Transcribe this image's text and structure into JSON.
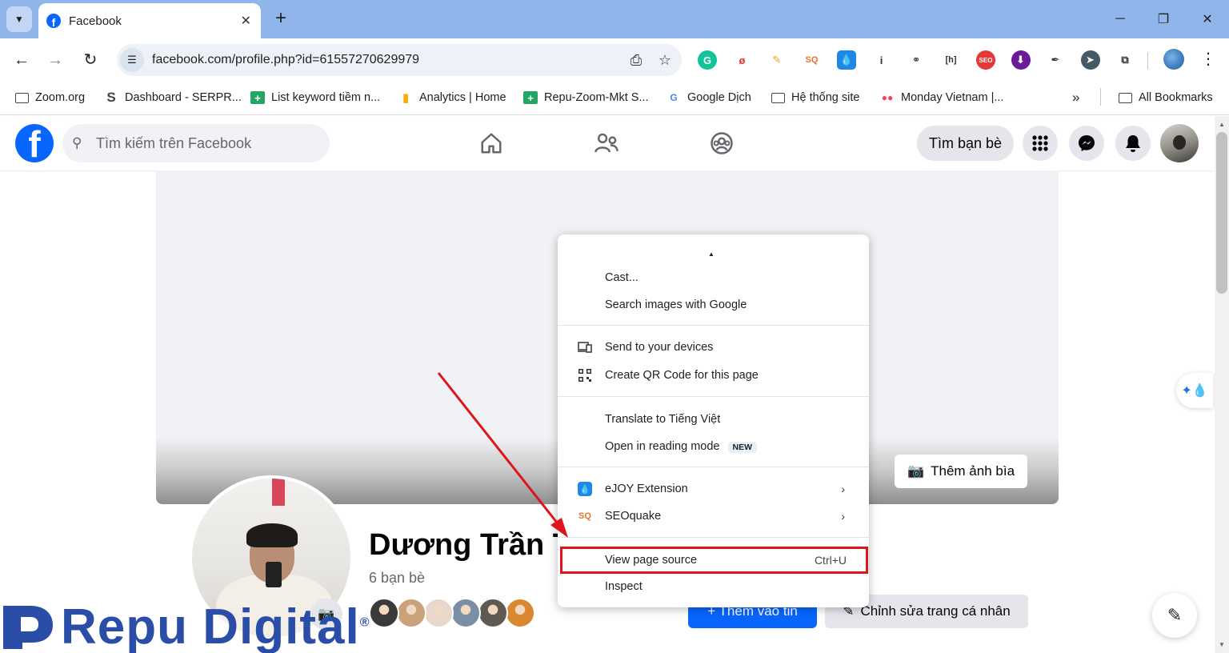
{
  "browser": {
    "tab_title": "Facebook",
    "tab_close": "✕",
    "new_tab": "+",
    "url": "facebook.com/profile.php?id=61557270629979",
    "window_controls": [
      "─",
      "❐",
      "✕"
    ],
    "extensions": [
      {
        "icon": "grammarly-icon",
        "glyph": "G",
        "color": "#15c39a"
      },
      {
        "icon": "ext-red-icon",
        "glyph": "ø",
        "color": "#ffffff"
      },
      {
        "icon": "highlighter-icon",
        "glyph": "✎",
        "color": "#ffffff"
      },
      {
        "icon": "seoquake-icon",
        "glyph": "SQ",
        "color": "#ffffff"
      },
      {
        "icon": "ejoy-icon",
        "glyph": "💧",
        "color": "#1e88e5"
      },
      {
        "icon": "info-icon",
        "glyph": "i",
        "color": "#ffffff"
      },
      {
        "icon": "link-icon",
        "glyph": "⚭",
        "color": "#ffffff"
      },
      {
        "icon": "heading-icon",
        "glyph": "[h]",
        "color": "#ffffff"
      },
      {
        "icon": "seo-icon",
        "glyph": "SEO",
        "color": "#e53935"
      },
      {
        "icon": "download-icon",
        "glyph": "⬇",
        "color": "#6a1b9a"
      },
      {
        "icon": "eyedropper-icon",
        "glyph": "✒",
        "color": "#ffffff"
      },
      {
        "icon": "cursor-icon",
        "glyph": "➤",
        "color": "#455a64"
      },
      {
        "icon": "puzzle-icon",
        "glyph": "⧉",
        "color": "#ffffff"
      }
    ],
    "bookmarks": [
      {
        "label": "Zoom.org",
        "icon": "folder-icon"
      },
      {
        "label": "Dashboard - SERPR...",
        "icon": "serprobot-icon"
      },
      {
        "label": "List keyword tiềm n...",
        "icon": "sheets-icon"
      },
      {
        "label": "Analytics | Home",
        "icon": "analytics-icon"
      },
      {
        "label": "Repu-Zoom-Mkt S...",
        "icon": "sheets-icon"
      },
      {
        "label": "Google Dịch",
        "icon": "translate-icon"
      },
      {
        "label": "Hệ thống site",
        "icon": "folder-icon"
      },
      {
        "label": "Monday Vietnam |...",
        "icon": "monday-icon"
      }
    ],
    "bookmarks_overflow": "»",
    "all_bookmarks": "All Bookmarks"
  },
  "facebook": {
    "search_placeholder": "Tìm kiếm trên Facebook",
    "find_friends": "Tìm bạn bè",
    "add_cover": "Thêm ảnh bìa",
    "profile_name": "Dương Trần T",
    "friends_count": "6 bạn bè",
    "add_story": "+ Thêm vào tin",
    "edit_profile": "Chỉnh sửa trang cá nhân",
    "friend_avatar_colors": [
      "#3a3a3a",
      "#c9a27a",
      "#e9d7cb",
      "#7a8fa6",
      "#5e5a52",
      "#d9882f"
    ]
  },
  "context_menu": {
    "items": [
      {
        "label": "Cast...",
        "icon": ""
      },
      {
        "label": "Search images with Google",
        "icon": ""
      },
      {
        "label": "Send to your devices",
        "icon": "devices-icon"
      },
      {
        "label": "Create QR Code for this page",
        "icon": "qr-code-icon"
      },
      {
        "label": "Translate to Tiếng Việt",
        "icon": ""
      },
      {
        "label": "Open in reading mode",
        "icon": "",
        "badge": "NEW"
      },
      {
        "label": "eJOY Extension",
        "icon": "ejoy-icon",
        "submenu": true
      },
      {
        "label": "SEOquake",
        "icon": "seoquake-icon",
        "submenu": true
      },
      {
        "label": "View page source",
        "icon": "",
        "shortcut": "Ctrl+U"
      },
      {
        "label": "Inspect",
        "icon": ""
      }
    ]
  },
  "watermark": {
    "text": "Repu Digital",
    "reg": "®"
  },
  "colors": {
    "chrome_frame": "#8fb5ea",
    "facebook_blue": "#0866ff",
    "highlight_red": "#e0141b",
    "watermark_blue": "#2a4ea8"
  }
}
